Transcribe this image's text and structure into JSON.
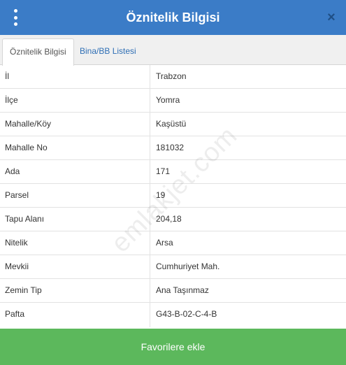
{
  "header": {
    "title": "Öznitelik Bilgisi",
    "menu_icon": "kebab-menu-icon",
    "close_icon": "close-icon",
    "close_glyph": "×"
  },
  "tabs": [
    {
      "label": "Öznitelik Bilgisi",
      "active": true
    },
    {
      "label": "Bina/BB Listesi",
      "active": false
    }
  ],
  "rows": [
    {
      "key": "İl",
      "value": "Trabzon"
    },
    {
      "key": "İlçe",
      "value": "Yomra"
    },
    {
      "key": "Mahalle/Köy",
      "value": "Kaşüstü"
    },
    {
      "key": "Mahalle No",
      "value": "181032"
    },
    {
      "key": "Ada",
      "value": "171"
    },
    {
      "key": "Parsel",
      "value": "19"
    },
    {
      "key": "Tapu Alanı",
      "value": "204,18"
    },
    {
      "key": "Nitelik",
      "value": "Arsa"
    },
    {
      "key": "Mevkii",
      "value": "Cumhuriyet Mah."
    },
    {
      "key": "Zemin Tip",
      "value": "Ana Taşınmaz"
    },
    {
      "key": "Pafta",
      "value": "G43-B-02-C-4-B"
    }
  ],
  "footer": {
    "button_label": "Favorilere ekle"
  },
  "watermark": "emlakjet.com",
  "colors": {
    "header": "#3b7cc7",
    "footer": "#5cb85c",
    "tab_link": "#2f6fb5"
  }
}
